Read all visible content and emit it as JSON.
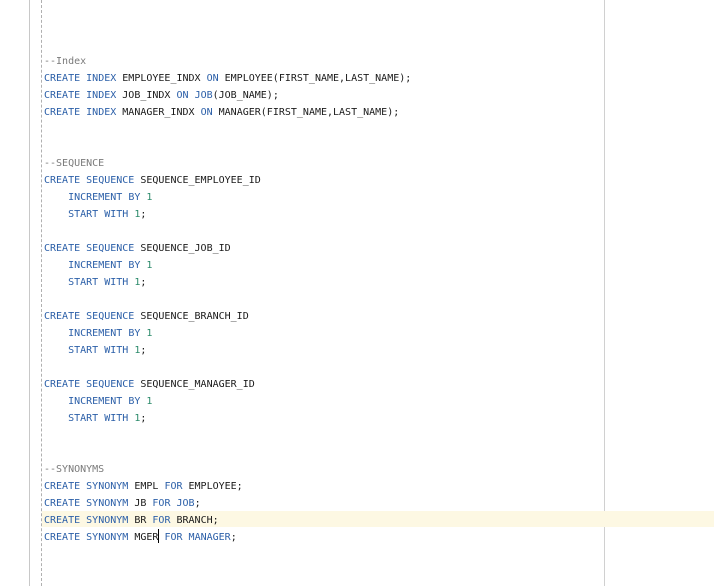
{
  "editor": {
    "lines": [
      {
        "tokens": []
      },
      {
        "tokens": [
          {
            "t": "--Index",
            "k": "cm"
          }
        ]
      },
      {
        "tokens": [
          {
            "t": "CREATE",
            "k": "kw"
          },
          {
            "t": " "
          },
          {
            "t": "INDEX",
            "k": "kw"
          },
          {
            "t": " EMPLOYEE_INDX "
          },
          {
            "t": "ON",
            "k": "kw"
          },
          {
            "t": " EMPLOYEE(FIRST_NAME,LAST_NAME);"
          }
        ]
      },
      {
        "tokens": [
          {
            "t": "CREATE",
            "k": "kw"
          },
          {
            "t": " "
          },
          {
            "t": "INDEX",
            "k": "kw"
          },
          {
            "t": " JOB_INDX "
          },
          {
            "t": "ON",
            "k": "kw"
          },
          {
            "t": " "
          },
          {
            "t": "JOB",
            "k": "kw"
          },
          {
            "t": "(JOB_NAME);"
          }
        ]
      },
      {
        "tokens": [
          {
            "t": "CREATE",
            "k": "kw"
          },
          {
            "t": " "
          },
          {
            "t": "INDEX",
            "k": "kw"
          },
          {
            "t": " MANAGER_INDX "
          },
          {
            "t": "ON",
            "k": "kw"
          },
          {
            "t": " MANAGER(FIRST_NAME,LAST_NAME);"
          }
        ]
      },
      {
        "tokens": []
      },
      {
        "tokens": []
      },
      {
        "tokens": [
          {
            "t": "--SEQUENCE",
            "k": "cm"
          }
        ]
      },
      {
        "tokens": [
          {
            "t": "CREATE",
            "k": "kw"
          },
          {
            "t": " "
          },
          {
            "t": "SEQUENCE",
            "k": "kw"
          },
          {
            "t": " SEQUENCE_EMPLOYEE_ID"
          }
        ]
      },
      {
        "tokens": [
          {
            "t": "    "
          },
          {
            "t": "INCREMENT",
            "k": "kw"
          },
          {
            "t": " "
          },
          {
            "t": "BY",
            "k": "kw"
          },
          {
            "t": " "
          },
          {
            "t": "1",
            "k": "num"
          }
        ]
      },
      {
        "tokens": [
          {
            "t": "    "
          },
          {
            "t": "START",
            "k": "kw"
          },
          {
            "t": " "
          },
          {
            "t": "WITH",
            "k": "kw"
          },
          {
            "t": " "
          },
          {
            "t": "1",
            "k": "num"
          },
          {
            "t": ";"
          }
        ]
      },
      {
        "tokens": []
      },
      {
        "tokens": [
          {
            "t": "CREATE",
            "k": "kw"
          },
          {
            "t": " "
          },
          {
            "t": "SEQUENCE",
            "k": "kw"
          },
          {
            "t": " SEQUENCE_JOB_ID"
          }
        ]
      },
      {
        "tokens": [
          {
            "t": "    "
          },
          {
            "t": "INCREMENT",
            "k": "kw"
          },
          {
            "t": " "
          },
          {
            "t": "BY",
            "k": "kw"
          },
          {
            "t": " "
          },
          {
            "t": "1",
            "k": "num"
          }
        ]
      },
      {
        "tokens": [
          {
            "t": "    "
          },
          {
            "t": "START",
            "k": "kw"
          },
          {
            "t": " "
          },
          {
            "t": "WITH",
            "k": "kw"
          },
          {
            "t": " "
          },
          {
            "t": "1",
            "k": "num"
          },
          {
            "t": ";"
          }
        ]
      },
      {
        "tokens": []
      },
      {
        "tokens": [
          {
            "t": "CREATE",
            "k": "kw"
          },
          {
            "t": " "
          },
          {
            "t": "SEQUENCE",
            "k": "kw"
          },
          {
            "t": " SEQUENCE_BRANCH_ID"
          }
        ]
      },
      {
        "tokens": [
          {
            "t": "    "
          },
          {
            "t": "INCREMENT",
            "k": "kw"
          },
          {
            "t": " "
          },
          {
            "t": "BY",
            "k": "kw"
          },
          {
            "t": " "
          },
          {
            "t": "1",
            "k": "num"
          }
        ]
      },
      {
        "tokens": [
          {
            "t": "    "
          },
          {
            "t": "START",
            "k": "kw"
          },
          {
            "t": " "
          },
          {
            "t": "WITH",
            "k": "kw"
          },
          {
            "t": " "
          },
          {
            "t": "1",
            "k": "num"
          },
          {
            "t": ";"
          }
        ]
      },
      {
        "tokens": []
      },
      {
        "tokens": [
          {
            "t": "CREATE",
            "k": "kw"
          },
          {
            "t": " "
          },
          {
            "t": "SEQUENCE",
            "k": "kw"
          },
          {
            "t": " SEQUENCE_MANAGER_ID"
          }
        ]
      },
      {
        "tokens": [
          {
            "t": "    "
          },
          {
            "t": "INCREMENT",
            "k": "kw"
          },
          {
            "t": " "
          },
          {
            "t": "BY",
            "k": "kw"
          },
          {
            "t": " "
          },
          {
            "t": "1",
            "k": "num"
          }
        ]
      },
      {
        "tokens": [
          {
            "t": "    "
          },
          {
            "t": "START",
            "k": "kw"
          },
          {
            "t": " "
          },
          {
            "t": "WITH",
            "k": "kw"
          },
          {
            "t": " "
          },
          {
            "t": "1",
            "k": "num"
          },
          {
            "t": ";"
          }
        ]
      },
      {
        "tokens": []
      },
      {
        "tokens": []
      },
      {
        "tokens": [
          {
            "t": "--SYNONYMS",
            "k": "cm"
          }
        ]
      },
      {
        "tokens": [
          {
            "t": "CREATE",
            "k": "kw"
          },
          {
            "t": " "
          },
          {
            "t": "SYNONYM",
            "k": "kw"
          },
          {
            "t": " EMPL "
          },
          {
            "t": "FOR",
            "k": "kw"
          },
          {
            "t": " EMPLOYEE;"
          }
        ]
      },
      {
        "tokens": [
          {
            "t": "CREATE",
            "k": "kw"
          },
          {
            "t": " "
          },
          {
            "t": "SYNONYM",
            "k": "kw"
          },
          {
            "t": " JB "
          },
          {
            "t": "FOR",
            "k": "kw"
          },
          {
            "t": " "
          },
          {
            "t": "JOB",
            "k": "kw"
          },
          {
            "t": ";"
          }
        ]
      },
      {
        "tokens": [
          {
            "t": "CREATE",
            "k": "kw"
          },
          {
            "t": " "
          },
          {
            "t": "SYNONYM",
            "k": "kw"
          },
          {
            "t": " BR "
          },
          {
            "t": "FOR",
            "k": "kw"
          },
          {
            "t": " BRANCH;"
          }
        ]
      },
      {
        "tokens": [
          {
            "t": "CREATE",
            "k": "kw"
          },
          {
            "t": " "
          },
          {
            "t": "SYNONYM",
            "k": "kw"
          },
          {
            "t": " MGER"
          },
          {
            "t": "",
            "k": "caret"
          },
          {
            "t": " "
          },
          {
            "t": "FOR",
            "k": "kw"
          },
          {
            "t": " "
          },
          {
            "t": "MANAGER",
            "k": "kw"
          },
          {
            "t": ";"
          }
        ]
      }
    ]
  },
  "colors": {
    "keyword": "#2b5fa8",
    "comment": "#7a7a7a",
    "number": "#2b8a6a",
    "current_line_bg": "#fdf8e3"
  }
}
